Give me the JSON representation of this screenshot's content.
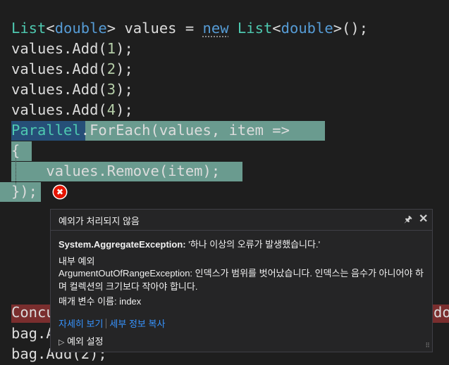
{
  "code": {
    "line1": {
      "t1": "List",
      "p1": "<",
      "k1": "double",
      "p2": "> values = ",
      "k2": "new",
      "p3": " ",
      "t2": "List",
      "p4": "<",
      "k3": "double",
      "p5": ">();"
    },
    "line2": {
      "p1": "values.Add(",
      "n1": "1",
      "p2": ");"
    },
    "line3": {
      "p1": "values.Add(",
      "n1": "2",
      "p2": ");"
    },
    "line4": {
      "p1": "values.Add(",
      "n1": "3",
      "p2": ");"
    },
    "line5": {
      "p1": "values.Add(",
      "n1": "4",
      "p2": ");"
    },
    "line6": {
      "t1": "Parallel",
      "p1": ".ForEach(values, item =>"
    },
    "line7": {
      "p1": "{"
    },
    "line8": {
      "p1": "    values.Remove(item);"
    },
    "line9": {
      "p1": "});"
    },
    "line10": {
      "t1": "Concu",
      "tr": "do"
    },
    "line11": {
      "p1": "bag.A"
    },
    "line12": {
      "p1": "bag.Add(2);"
    }
  },
  "popup": {
    "title": "예외가 처리되지 않음",
    "pin_icon": "pin-icon",
    "close_icon": "close-icon",
    "pin_glyph": "🖈",
    "close_glyph": "✕",
    "exception_type": "System.AggregateException:",
    "exception_message": " '하나 이상의 오류가 발생했습니다.'",
    "inner_header": "내부 예외",
    "inner_message": "ArgumentOutOfRangeException: 인덱스가 범위를 벗어났습니다. 인덱스는 음수가 아니어야 하며 컬렉션의 크기보다 작아야 합니다.",
    "param_line": "매개 변수 이름: index",
    "link_details": "자세히 보기",
    "link_copy": "세부 정보 복사",
    "settings_arrow": "▷",
    "settings_label": "예외 설정",
    "resize_grip": "⠿"
  },
  "colors": {
    "editor_bg": "#1e1e1e",
    "highlight": "#6a9b8f",
    "selection": "#264f78",
    "error": "#e51400",
    "link": "#3794ff"
  },
  "error_glyph": "✖"
}
